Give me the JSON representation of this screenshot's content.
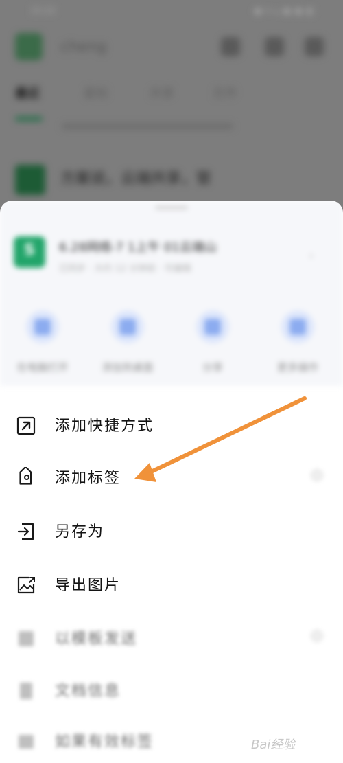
{
  "status_bar": {
    "time": "15:22",
    "indicators": "◼ ▾ ▴ ◼ ◼ ◧"
  },
  "background_app": {
    "user_name": "cheng",
    "header_icons": [
      "grid-icon",
      "search-icon",
      "more-icon"
    ],
    "tabs": [
      "最近",
      "星标",
      "共享",
      "文件"
    ],
    "row_title": "方案说，云端共享，管"
  },
  "sheet": {
    "file": {
      "icon_letter": "S",
      "title": "6.28网络-7 1上午 01云端山",
      "meta": "已同步 · 大约 12 分钟前 · 可编辑"
    },
    "quick_actions": [
      {
        "label": "在电脑打开",
        "icon": "computer-icon"
      },
      {
        "label": "添加到桌面",
        "icon": "desktop-icon"
      },
      {
        "label": "分享",
        "icon": "share-icon"
      },
      {
        "label": "更多操作",
        "icon": "more-icon"
      }
    ],
    "menu": [
      {
        "label": "添加快捷方式",
        "icon": "shortcut-arrow-icon"
      },
      {
        "label": "添加标签",
        "icon": "tag-icon"
      },
      {
        "label": "另存为",
        "icon": "save-as-icon"
      },
      {
        "label": "导出图片",
        "icon": "export-image-icon"
      },
      {
        "label": "以模板发送",
        "icon": "template-icon"
      },
      {
        "label": "文档信息",
        "icon": "document-icon"
      },
      {
        "label": "如果有效标签",
        "icon": "folder-icon"
      }
    ]
  },
  "annotation": {
    "color": "#f0923a"
  },
  "watermark": {
    "text": "Bai经验"
  },
  "colors": {
    "accent_green": "#22a56a",
    "sheet_bg": "#ffffff",
    "dim_overlay": "#7d7d7d"
  }
}
